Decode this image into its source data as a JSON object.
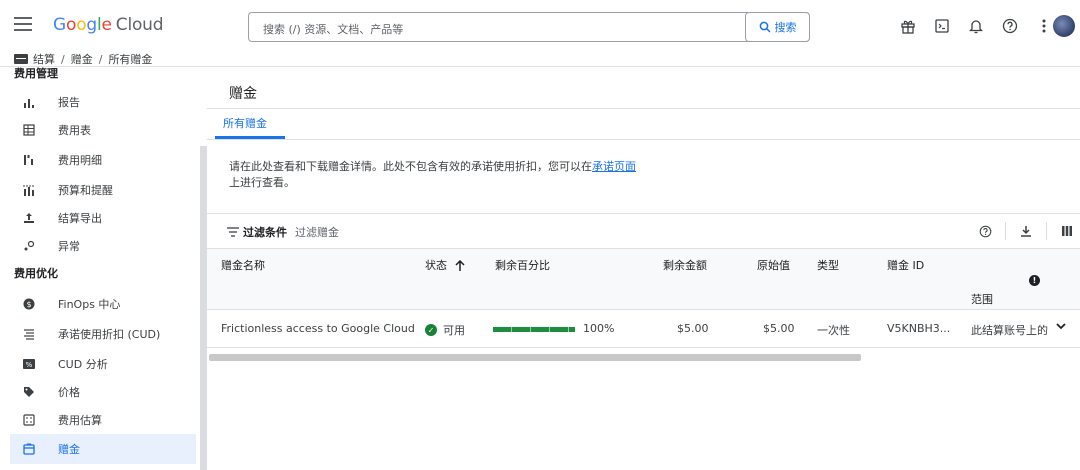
{
  "header": {
    "logo_google": [
      "G",
      "o",
      "o",
      "g",
      "l",
      "e"
    ],
    "logo_cloud": "Cloud",
    "search_placeholder": "搜索 (/) 资源、文档、产品等",
    "search_button": "搜索"
  },
  "breadcrumb": [
    "结算",
    "赠金",
    "所有赠金"
  ],
  "sidebar": {
    "section_billing": "费用管理",
    "billing_items": [
      {
        "label": "报告",
        "icon": "bar-chart-icon"
      },
      {
        "label": "费用表",
        "icon": "table-icon"
      },
      {
        "label": "费用明细",
        "icon": "breakdown-icon"
      },
      {
        "label": "预算和提醒",
        "icon": "budget-icon"
      },
      {
        "label": "结算导出",
        "icon": "export-icon"
      },
      {
        "label": "异常",
        "icon": "anomaly-icon"
      }
    ],
    "section_opt": "费用优化",
    "opt_items": [
      {
        "label": "FinOps 中心",
        "icon": "finops-icon"
      },
      {
        "label": "承诺使用折扣 (CUD)",
        "icon": "cud-icon"
      },
      {
        "label": "CUD 分析",
        "icon": "percent-icon"
      },
      {
        "label": "价格",
        "icon": "tag-icon"
      },
      {
        "label": "费用估算",
        "icon": "calculator-icon"
      },
      {
        "label": "赠金",
        "icon": "credit-icon"
      }
    ]
  },
  "main": {
    "title": "赠金",
    "tab": "所有赠金",
    "desc_part1": "请在此处查看和下载赠金详情。此处不包含有效的承诺使用折扣，您可以在",
    "desc_link": "承诺页面",
    "desc_part2": "上进行查看。",
    "filter_label": "过滤条件",
    "filter_placeholder": "过滤赠金"
  },
  "table": {
    "headers": {
      "name": "赠金名称",
      "status": "状态",
      "remaining_pct": "剩余百分比",
      "remaining_amt": "剩余金额",
      "original": "原始值",
      "type": "类型",
      "credit_id": "赠金 ID",
      "scope": "范围"
    },
    "rows": [
      {
        "name": "Frictionless access to Google Cloud",
        "status": "可用",
        "remaining_fraction": 1.0,
        "remaining_pct": "100%",
        "remaining_amt": "$5.00",
        "original": "$5.00",
        "type": "一次性",
        "credit_id": "V5KNBH3...",
        "scope": "此结算账号上的"
      }
    ]
  },
  "colors": {
    "accent": "#1a73e8",
    "success": "#188038"
  }
}
